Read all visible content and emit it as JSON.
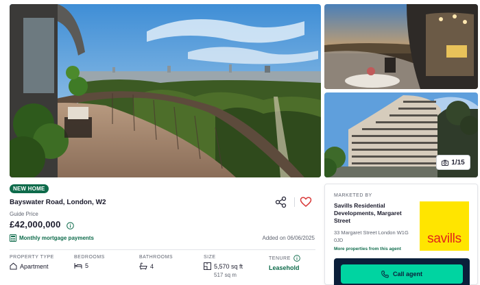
{
  "gallery": {
    "main_image": "balcony-park-view",
    "side_images": [
      "interior-terrace-sunset",
      "building-exterior"
    ],
    "photo_count": "1/15"
  },
  "listing": {
    "badge": "NEW HOME",
    "address": "Bayswater Road, London, W2",
    "guide_label": "Guide Price",
    "price": "£42,000,000",
    "mortgage_link": "Monthly mortgage payments",
    "added": "Added on 06/06/2025"
  },
  "features": [
    {
      "label": "PROPERTY TYPE",
      "value": "Apartment",
      "icon": "house-icon"
    },
    {
      "label": "BEDROOMS",
      "value": "5",
      "icon": "bed-icon"
    },
    {
      "label": "BATHROOMS",
      "value": "4",
      "icon": "bath-icon"
    },
    {
      "label": "SIZE",
      "value": "5,570 sq ft",
      "sub": "517 sq m",
      "icon": "floorplan-icon"
    },
    {
      "label": "TENURE",
      "value": "Leasehold",
      "icon": "info-icon"
    }
  ],
  "agent": {
    "marketed_by": "MARKETED BY",
    "name": "Savills Residential Developments, Margaret Street",
    "address": "33 Margaret Street London W1G 0JD",
    "more_link": "More properties from this agent",
    "logo_text": "savills",
    "call_label": "Call agent"
  },
  "colors": {
    "brand_green": "#0e6b4b",
    "call_button": "#00d4a1",
    "navy": "#0b1f3a",
    "savills_yellow": "#ffe500",
    "savills_red": "#e2231a",
    "favourite": "#d93a3a"
  }
}
